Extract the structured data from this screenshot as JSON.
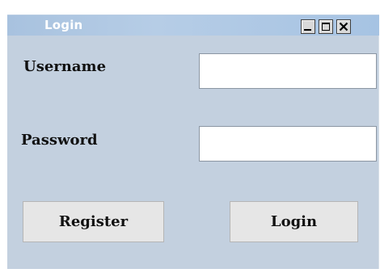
{
  "window": {
    "title": "Login",
    "controls": {
      "minimize": "minimize-icon",
      "maximize": "maximize-icon",
      "close": "close-icon"
    }
  },
  "form": {
    "username_label": "Username",
    "username_value": "",
    "password_label": "Password",
    "password_value": ""
  },
  "buttons": {
    "register_label": "Register",
    "login_label": "Login"
  },
  "colors": {
    "window_bg": "#c3d0df",
    "titlebar": "#a8c2df",
    "button_bg": "#e6e6e6"
  }
}
